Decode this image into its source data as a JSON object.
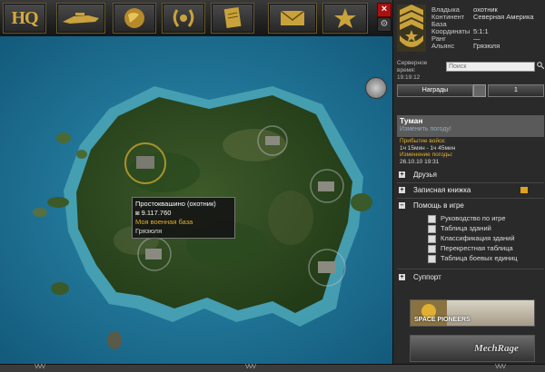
{
  "toolbar": {
    "hq_label": "HQ",
    "buttons": [
      "units-icon",
      "globe-icon",
      "laurel-icon",
      "report-icon",
      "mail-icon",
      "star-icon"
    ],
    "close_label": "×",
    "gear_label": "⚙"
  },
  "map": {
    "tooltip": {
      "title": "Простоквашино (охотник)",
      "coins": "9.117.760",
      "base": "Моя военная база",
      "alliance": "Грязюля"
    }
  },
  "bottom": {
    "marks": "VVV"
  },
  "profile": {
    "rows": [
      {
        "label": "Владыка",
        "value": "охотник"
      },
      {
        "label": "Континент",
        "value": "Северная Америка"
      },
      {
        "label": "База",
        "value": ""
      },
      {
        "label": "Координаты",
        "value": "5:1:1"
      },
      {
        "label": "Ранг",
        "value": "—"
      },
      {
        "label": "Альянс",
        "value": "Грязюля"
      }
    ],
    "server_label": "Серверное время:",
    "server_time": "19:19:12",
    "search_placeholder": "Поиск",
    "awards_label": "Награды",
    "awards_count": "1"
  },
  "weather": {
    "title": "Туман",
    "change_link": "Изменить погоду!",
    "arrival_label": "Прибытие войск:",
    "arrival_value": "1ч 15мин - 1ч 45мин",
    "change_label": "Изменение погоды:",
    "change_value": "26.10.10 19:31"
  },
  "menu": {
    "friends": "Друзья",
    "notebook": "Записная книжка",
    "help": "Помощь в игре",
    "help_items": [
      "Руководство по игре",
      "Таблица зданий",
      "Классификация зданий",
      "Перекрестная таблица",
      "Таблица боевых единиц"
    ],
    "support": "Суппорт"
  },
  "banners": {
    "first": "SPACE PIONEERS",
    "second": "MechRage"
  }
}
